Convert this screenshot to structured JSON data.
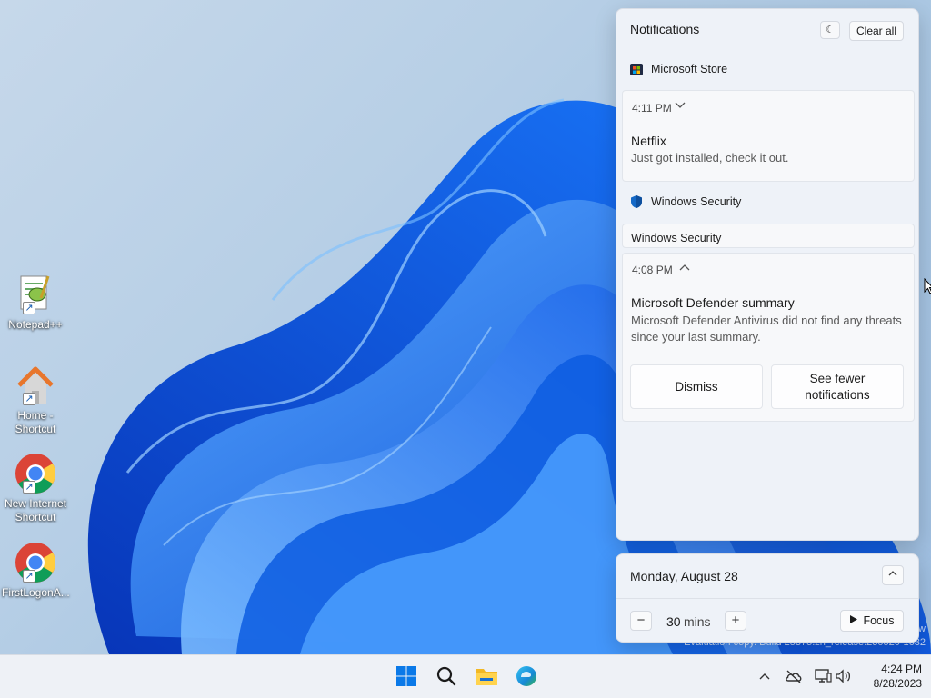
{
  "desktop": {
    "icons": [
      {
        "label": "Notepad++"
      },
      {
        "label": "Home - Shortcut"
      },
      {
        "label": "New Internet Shortcut"
      },
      {
        "label": "FirstLogonA..."
      }
    ]
  },
  "notification_center": {
    "title": "Notifications",
    "dnd_icon": "do-not-disturb-icon",
    "clear_all": "Clear all",
    "groups": [
      {
        "app": "Microsoft Store",
        "notifications": [
          {
            "time": "4:11 PM",
            "title": "Netflix",
            "body": "Just got installed, check it out."
          }
        ]
      },
      {
        "app": "Windows Security",
        "subheader": "Windows Security",
        "notifications": [
          {
            "time": "4:08 PM",
            "title": "Microsoft Defender summary",
            "body": "Microsoft Defender Antivirus did not find any threats since your last summary.",
            "actions": [
              "Dismiss",
              "See fewer notifications"
            ]
          }
        ]
      }
    ]
  },
  "calendar": {
    "date": "Monday, August 28",
    "focus_minutes": "30",
    "focus_unit": "mins",
    "minus": "−",
    "plus": "+",
    "focus_label": "Focus"
  },
  "watermark": {
    "line1": "w",
    "line2": "Evaluation copy. Build 25375.zn_release.230520-1632"
  },
  "taskbar": {
    "pinned": [
      "start-icon",
      "search-icon",
      "file-explorer-icon",
      "edge-icon"
    ],
    "tray": [
      "chevron-up-icon",
      "onedrive-offline-icon",
      "network-icon",
      "volume-icon"
    ],
    "time": "4:24 PM",
    "date": "8/28/2023"
  },
  "colors": {
    "accent": "#0067c0",
    "windows_blue": "#0a79e8"
  }
}
